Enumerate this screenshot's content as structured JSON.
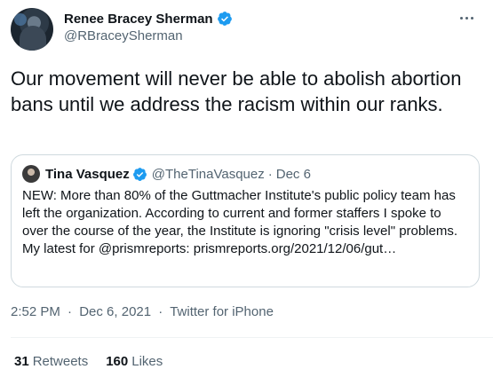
{
  "author": {
    "display_name": "Renee Bracey Sherman",
    "handle": "@RBraceySherman",
    "verified_icon": "verified-badge-icon",
    "avatar_icon": "avatar"
  },
  "tweet": {
    "text": "Our movement will never be able to abolish abortion bans until we address the racism within our ranks."
  },
  "quoted_tweet": {
    "display_name": "Tina Vasquez",
    "handle": "@TheTinaVasquez",
    "separator": "·",
    "date": "Dec 6",
    "text": "NEW: More than 80% of the Guttmacher Institute's public policy team has left the organization. According to current and former staffers I spoke to over the course of the year, the Institute is ignoring \"crisis level\" problems. My latest for @prismreports: prismreports.org/2021/12/06/gut…"
  },
  "meta": {
    "time": "2:52 PM",
    "separator1": "·",
    "date": "Dec 6, 2021",
    "separator2": "·",
    "source": "Twitter for iPhone"
  },
  "stats": {
    "retweets_count": "31",
    "retweets_label": "Retweets",
    "likes_count": "160",
    "likes_label": "Likes"
  },
  "colors": {
    "verified": "#1d9bf0",
    "secondary_text": "#536471",
    "primary_text": "#0f1419",
    "border": "#cfd9de"
  }
}
